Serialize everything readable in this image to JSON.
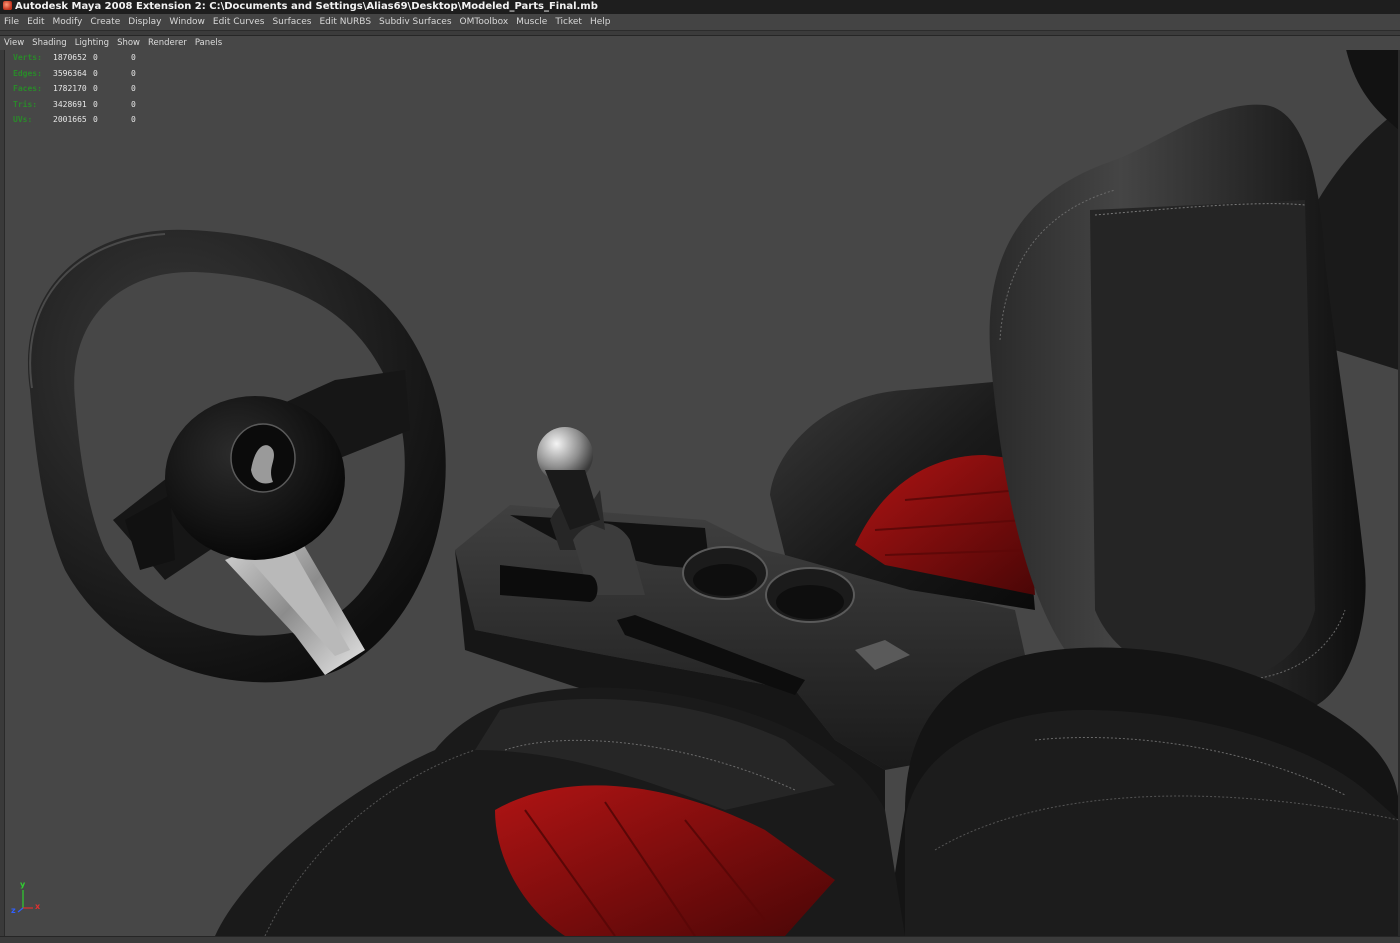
{
  "window": {
    "title": "Autodesk Maya 2008 Extension 2: C:\\Documents and Settings\\Alias69\\Desktop\\Modeled_Parts_Final.mb",
    "app_icon": "maya-icon"
  },
  "menubar": {
    "items": [
      "File",
      "Edit",
      "Modify",
      "Create",
      "Display",
      "Window",
      "Edit Curves",
      "Surfaces",
      "Edit NURBS",
      "Subdiv Surfaces",
      "OMToolbox",
      "Muscle",
      "Ticket",
      "Help"
    ]
  },
  "panel_menu": {
    "items": [
      "View",
      "Shading",
      "Lighting",
      "Show",
      "Renderer",
      "Panels"
    ]
  },
  "hud": {
    "rows": [
      {
        "label": "Verts:",
        "v1": "1870652",
        "v2": "0",
        "v3": "0"
      },
      {
        "label": "Edges:",
        "v1": "3596364",
        "v2": "0",
        "v3": "0"
      },
      {
        "label": "Faces:",
        "v1": "1782170",
        "v2": "0",
        "v3": "0"
      },
      {
        "label": "Tris:",
        "v1": "3428691",
        "v2": "0",
        "v3": "0"
      },
      {
        "label": "UVs:",
        "v1": "2001665",
        "v2": "0",
        "v3": "0"
      }
    ]
  },
  "axis": {
    "y": "y",
    "x": "x",
    "z": "z",
    "colors": {
      "x": "#e03030",
      "y": "#30d030",
      "z": "#3060ff"
    }
  },
  "colors": {
    "viewport_bg": "#474747",
    "leather": "#1c1c1c",
    "red_insert": "#8a0e0e",
    "hud_label": "#2a8a2a"
  }
}
